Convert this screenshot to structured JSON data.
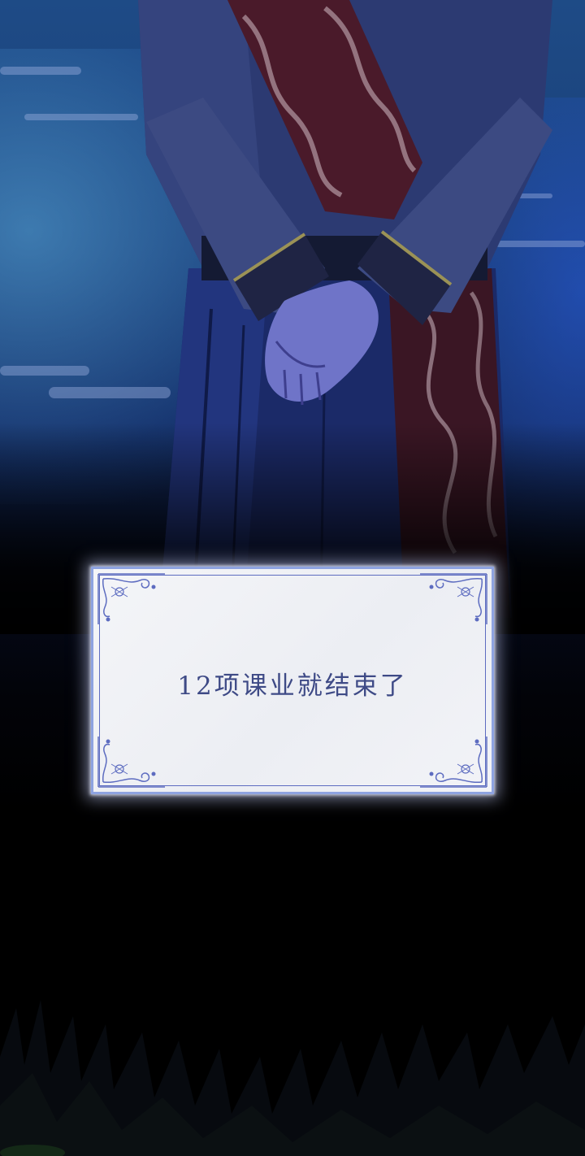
{
  "caption": {
    "text": "12项课业就结束了"
  },
  "colors": {
    "sky": "#1e4b86",
    "robe": "#1d2c6c",
    "sash": "#4a1a2a",
    "caption_border": "#8ea3e0",
    "caption_text": "#3e4a86"
  }
}
